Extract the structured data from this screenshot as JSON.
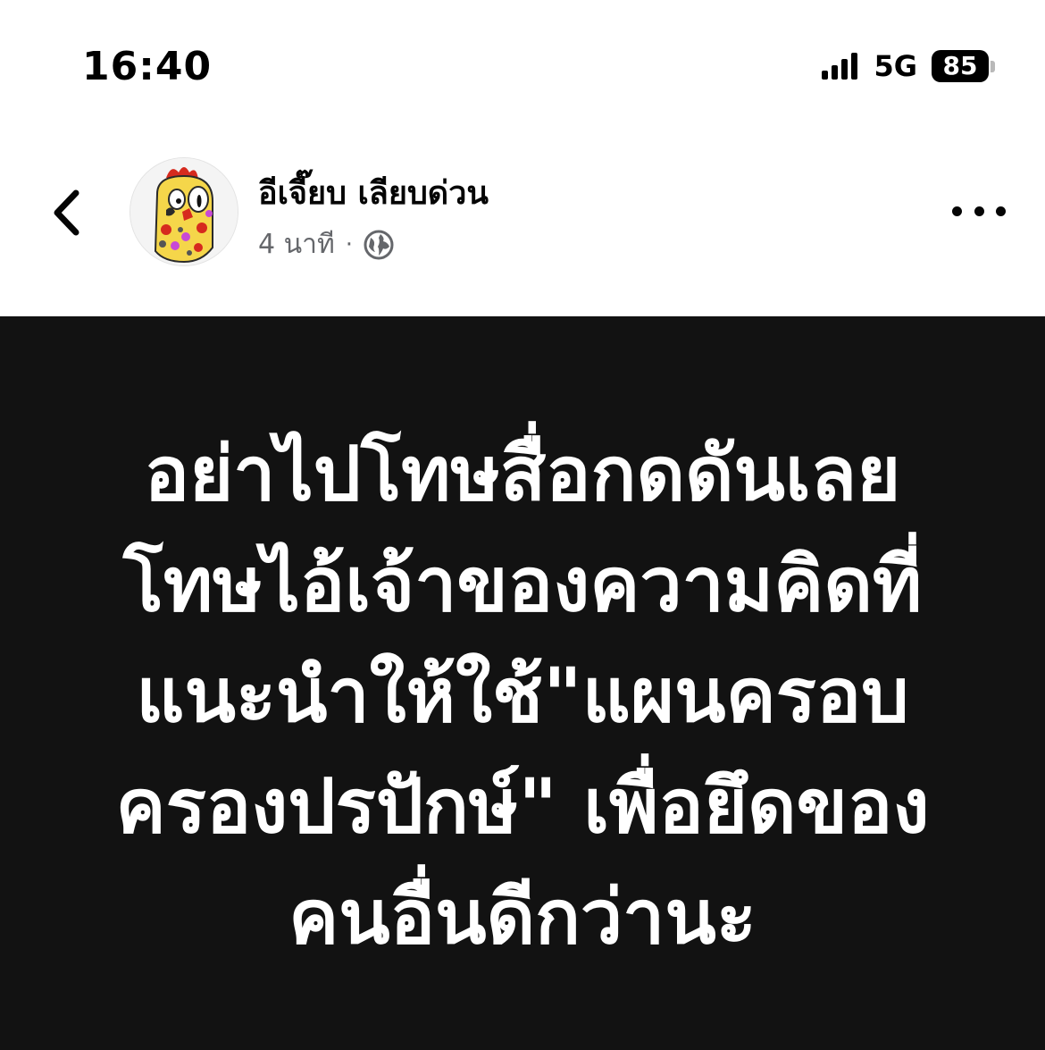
{
  "status_bar": {
    "time": "16:40",
    "network": "5G",
    "battery": "85"
  },
  "header": {
    "back_icon": "chevron-left-icon",
    "author_name": "อีเจี๊ยบ เลียบด่วน",
    "post_time": "4 นาที",
    "separator": "·",
    "privacy_icon": "globe-icon",
    "more_icon": "more-horizontal-icon"
  },
  "post": {
    "background": "#121212",
    "text_color": "#ffffff",
    "lines": [
      "อย่าไปโทษสื่อกดดันเลย",
      "โทษไอ้เจ้าของความคิดที่",
      "แนะนำให้ใช้\"แผนครอบ",
      "ครองปรปักษ์\" เพื่อยึดของ",
      "คนอื่นดีกว่านะ"
    ]
  }
}
